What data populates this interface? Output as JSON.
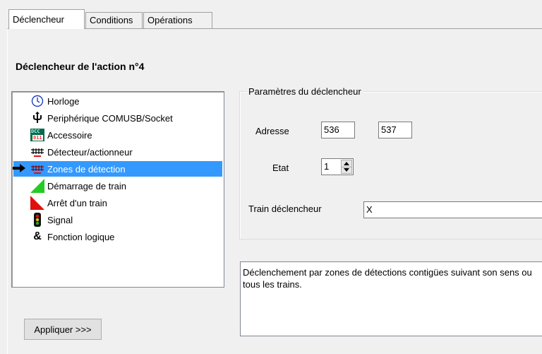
{
  "tabs": [
    {
      "label": "Déclencheur",
      "active": true
    },
    {
      "label": "Conditions",
      "active": false
    },
    {
      "label": "Opérations",
      "active": false
    }
  ],
  "page_title": "Déclencheur de l'action n°4",
  "trigger_list": {
    "items": [
      {
        "label": "Horloge",
        "icon": "clock-icon"
      },
      {
        "label": "Periphérique COMUSB/Socket",
        "icon": "usb-icon"
      },
      {
        "label": "Accessoire",
        "icon": "dcc-accessory-icon",
        "icon_text_top": "DCC",
        "icon_text_bottom": "011"
      },
      {
        "label": "Détecteur/actionneur",
        "icon": "detector-icon"
      },
      {
        "label": "Zones de détection",
        "icon": "detection-zone-icon",
        "selected": true
      },
      {
        "label": "Démarrage de train",
        "icon": "train-start-icon"
      },
      {
        "label": "Arrêt d'un train",
        "icon": "train-stop-icon"
      },
      {
        "label": "Signal",
        "icon": "signal-icon"
      },
      {
        "label": "Fonction logique",
        "icon": "logic-function-icon",
        "icon_text": "&"
      }
    ]
  },
  "params": {
    "legend": "Paramètres du déclencheur",
    "adresse_label": "Adresse",
    "adresse1": "536",
    "adresse2": "537",
    "etat_label": "Etat",
    "etat_value": "1",
    "train_label": "Train déclencheur",
    "train_value": "X"
  },
  "description": "Déclenchement par zones de détections contigües suivant son sens ou tous les trains.",
  "apply_button": "Appliquer >>>",
  "colors": {
    "selection": "#3399ff",
    "green": "#22cc22",
    "red": "#e01010"
  }
}
